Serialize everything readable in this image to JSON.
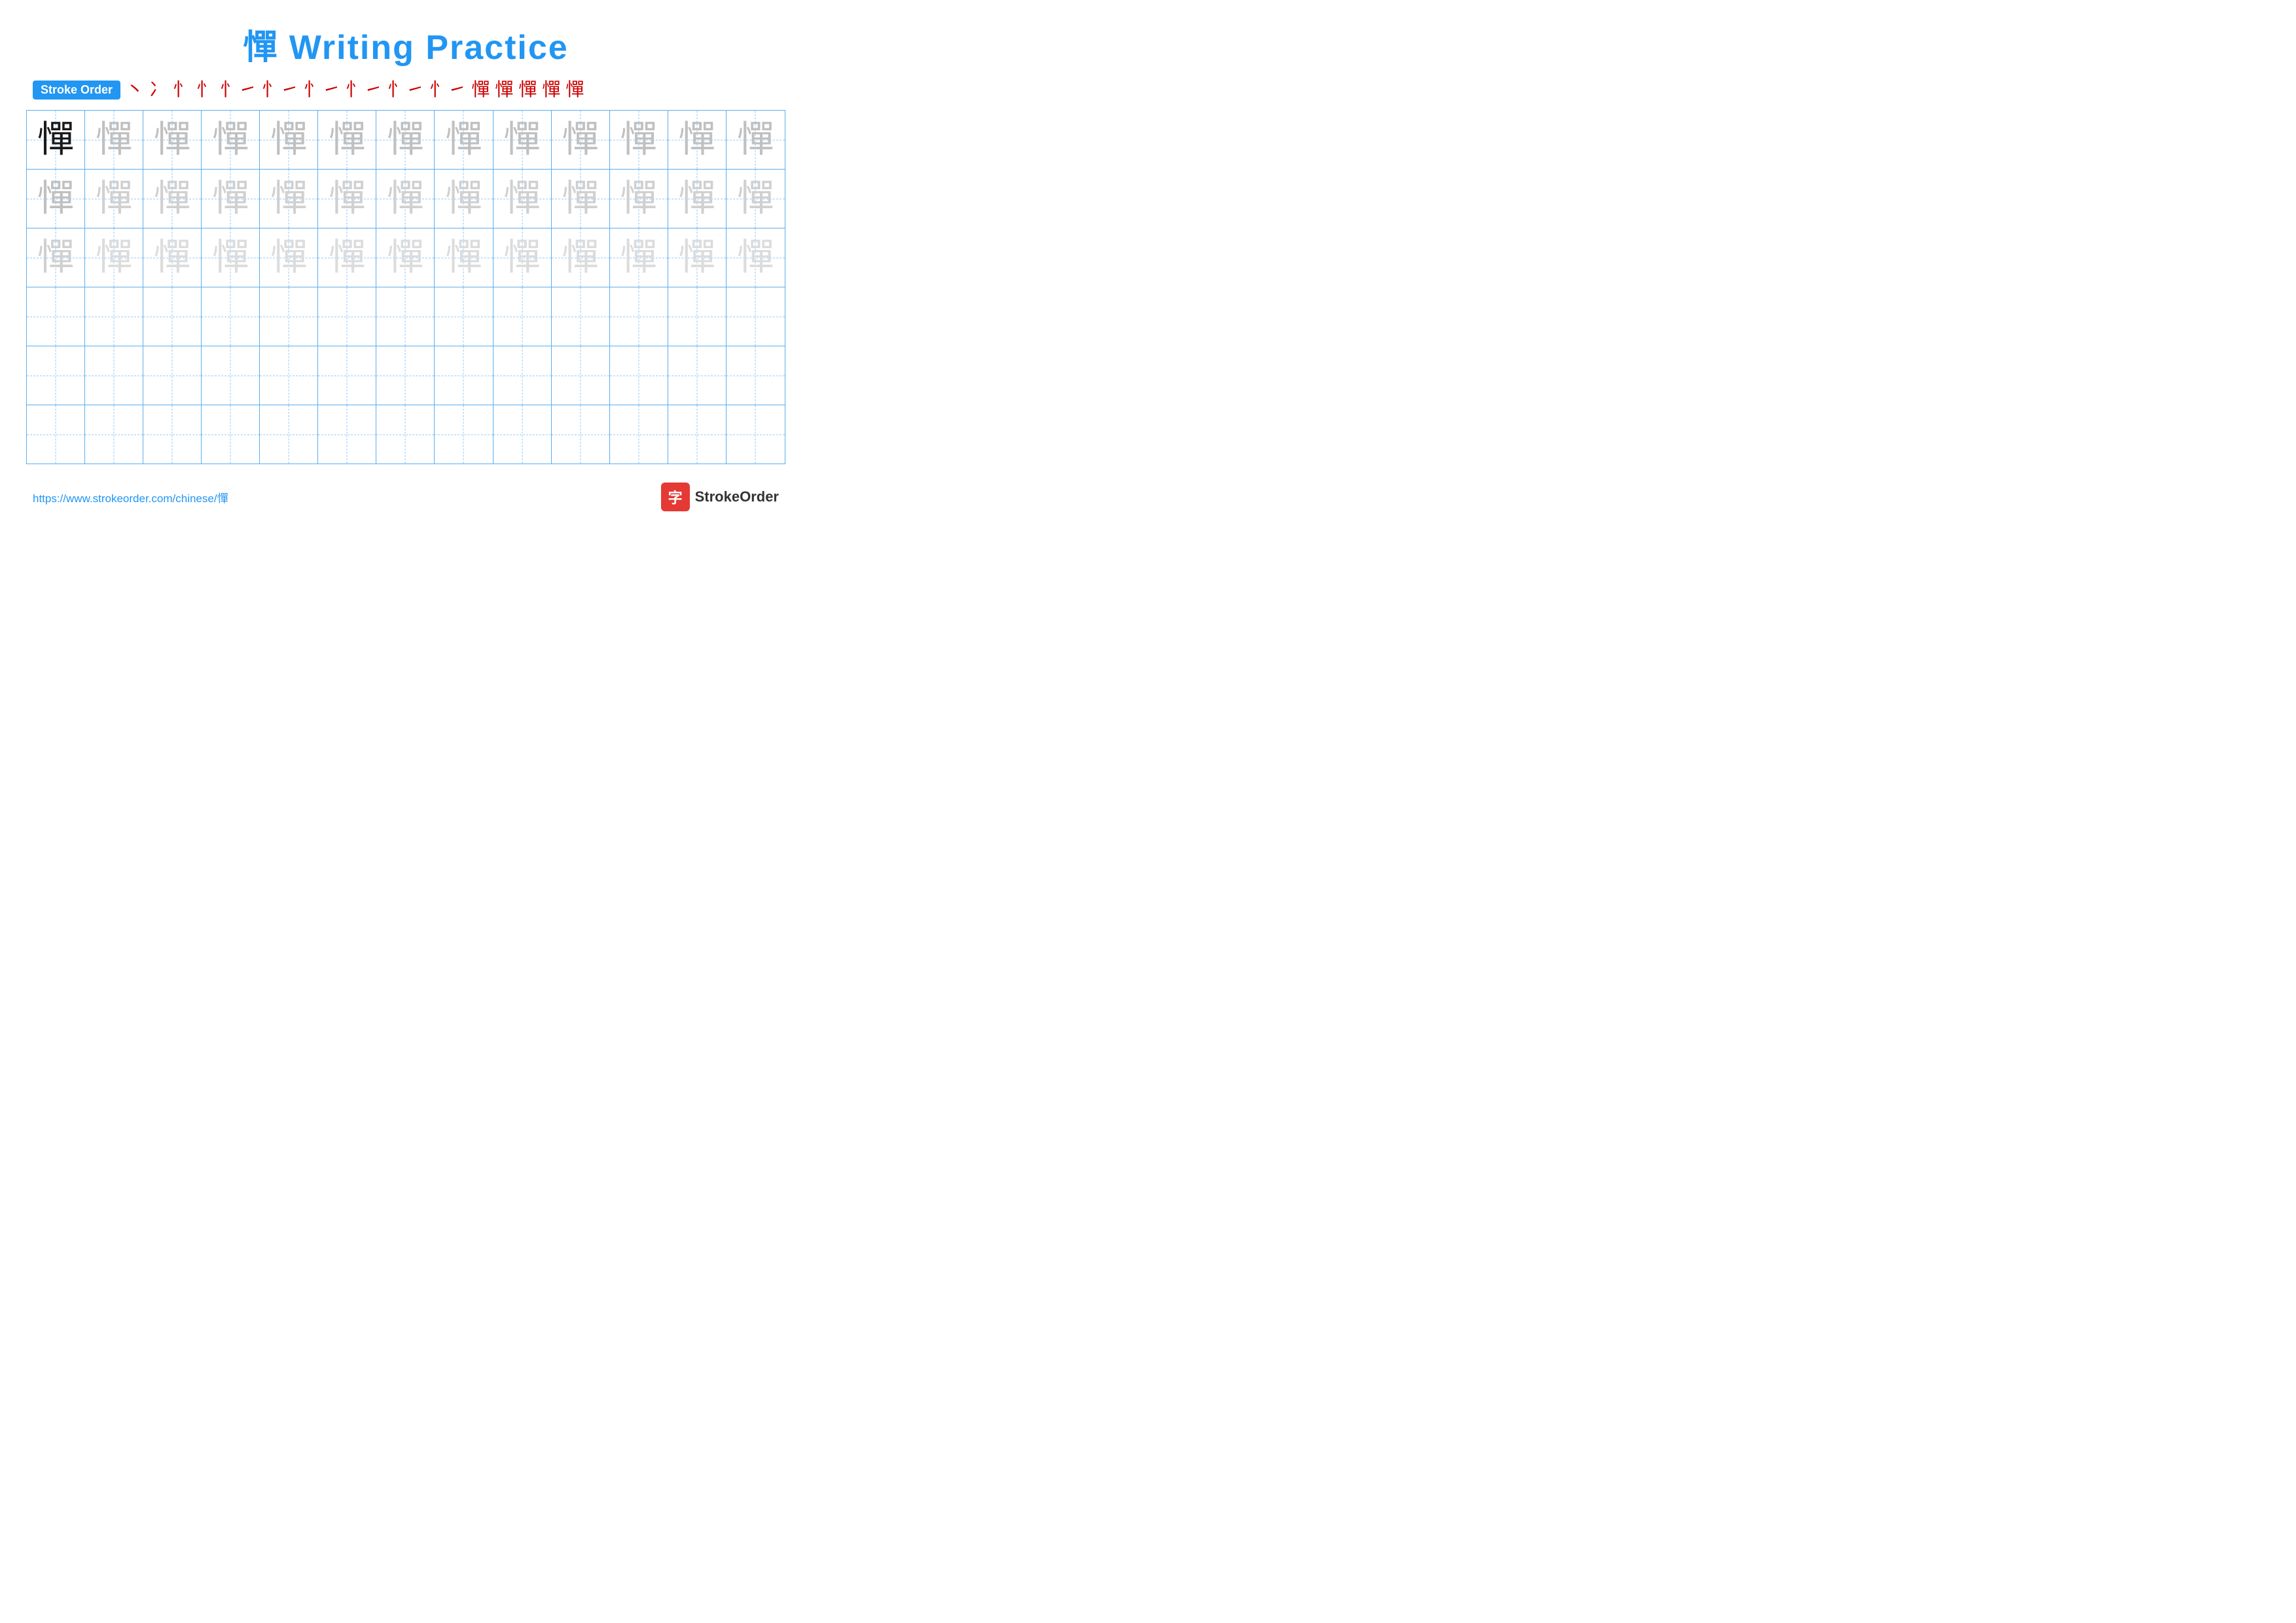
{
  "title": "憚 Writing Practice",
  "stroke_order_label": "Stroke Order",
  "stroke_chars": [
    "丶",
    "冫",
    "忄",
    "忄",
    "忄",
    "忄",
    "忄",
    "忄",
    "忄",
    "忄",
    "憚",
    "憚",
    "憚",
    "憚",
    "憚"
  ],
  "main_char": "憚",
  "grid": {
    "rows": 6,
    "cols": 13,
    "row_types": [
      "dark",
      "light1",
      "light2",
      "empty",
      "empty",
      "empty"
    ]
  },
  "footer": {
    "url": "https://www.strokeorder.com/chinese/憚",
    "brand": "StrokeOrder",
    "logo_char": "字"
  }
}
